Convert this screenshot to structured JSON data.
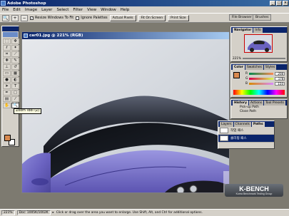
{
  "window": {
    "title": "Adobe Photoshop"
  },
  "menu": [
    "File",
    "Edit",
    "Image",
    "Layer",
    "Select",
    "Filter",
    "View",
    "Window",
    "Help"
  ],
  "options": {
    "zoom_in_icon": "magnify-plus-icon",
    "zoom_out_icon": "magnify-minus-icon",
    "resize_windows_label": "Resize Windows To Fit",
    "ignore_palettes_label": "Ignore Palettes",
    "actual_pixels_label": "Actual Pixels",
    "fit_on_screen_label": "Fit On Screen",
    "print_size_label": "Print Size"
  },
  "palette_well": {
    "file_browser": "File Browser",
    "brushes": "Brushes"
  },
  "tooltip": "Zoom Tool (Z)",
  "document": {
    "title": "car01.jpg @ 221% (RGB)"
  },
  "navigator": {
    "tabs": [
      "Navigator",
      "Info"
    ],
    "zoom": "221%"
  },
  "color": {
    "tabs": [
      "Color",
      "Swatches",
      "Styles"
    ],
    "channels": [
      {
        "label": "R",
        "value": "208"
      },
      {
        "label": "G",
        "value": "178"
      },
      {
        "label": "B",
        "value": "150"
      }
    ],
    "foreground": "#d98a50"
  },
  "history": {
    "tabs": [
      "History",
      "Actions",
      "Tool Presets"
    ],
    "items": [
      "Pick-up Path",
      "Close Path"
    ]
  },
  "paths": {
    "tabs": [
      "Layers",
      "Channels",
      "Paths"
    ],
    "items": [
      {
        "label": "작업 패스",
        "selected": false
      },
      {
        "label": "클리핑 패스",
        "selected": true
      }
    ]
  },
  "status": {
    "zoom": "221%",
    "doc_size": "Doc: 1005K/1002K",
    "hint": "Click or drag over the area you want to enlarge. Use Shift, Alt, and Ctrl for additional options."
  },
  "watermark": {
    "brand": "K-BENCH",
    "tagline": "Korea Benchmark Testing Group"
  }
}
